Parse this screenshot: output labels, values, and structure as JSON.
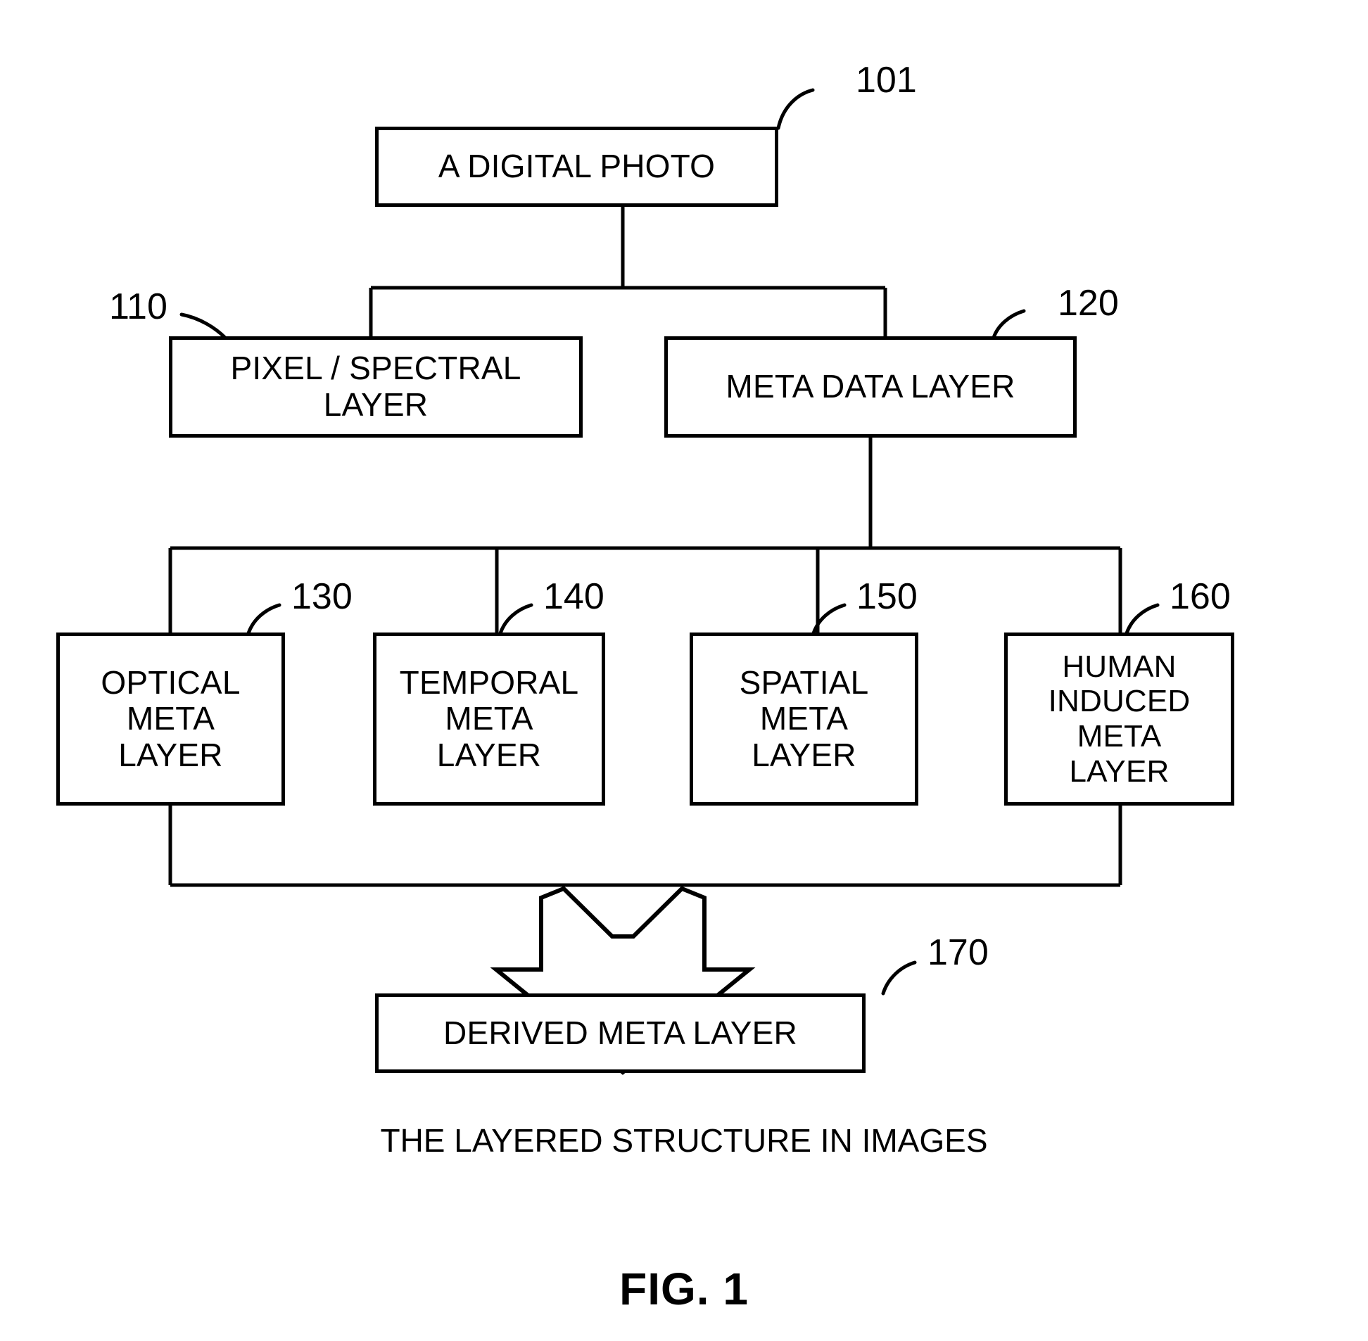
{
  "figure": {
    "title": "FIG. 1",
    "caption": "THE LAYERED STRUCTURE IN IMAGES",
    "ink_color": "#000000",
    "background_color": "#ffffff"
  },
  "nodes": {
    "digital_photo": {
      "label": "A DIGITAL PHOTO",
      "ref": "101"
    },
    "pixel_spectral_layer": {
      "label": "PIXEL / SPECTRAL\nLAYER",
      "ref": "110"
    },
    "meta_data_layer": {
      "label": "META DATA LAYER",
      "ref": "120"
    },
    "optical_meta_layer": {
      "label": "OPTICAL\nMETA\nLAYER",
      "ref": "130"
    },
    "temporal_meta_layer": {
      "label": "TEMPORAL\nMETA\nLAYER",
      "ref": "140"
    },
    "spatial_meta_layer": {
      "label": "SPATIAL\nMETA\nLAYER",
      "ref": "150"
    },
    "human_induced_meta_layer": {
      "label": "HUMAN\nINDUCED\nMETA\nLAYER",
      "ref": "160"
    },
    "derived_meta_layer": {
      "label": "DERIVED META LAYER",
      "ref": "170"
    }
  }
}
